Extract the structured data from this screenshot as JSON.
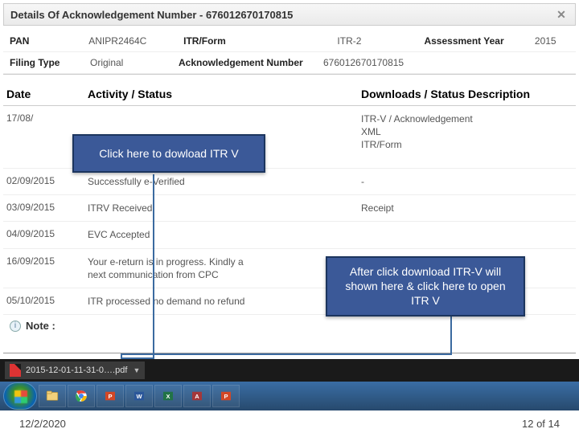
{
  "dialog": {
    "title": "Details Of Acknowledgement Number - 676012670170815"
  },
  "info": {
    "pan_label": "PAN",
    "pan": "ANIPR2464C",
    "itrform_label": "ITR/Form",
    "itrform": "ITR-2",
    "ay_label": "Assessment Year",
    "ay": "2015",
    "filing_label": "Filing Type",
    "filing": "Original",
    "ack_label": "Acknowledgement Number",
    "ack": "676012670170815"
  },
  "headers": {
    "date": "Date",
    "activity": "Activity / Status",
    "downloads": "Downloads / Status Description"
  },
  "rows": [
    {
      "date": "17/08/",
      "activity": "",
      "downloads": "ITR-V / Acknowledgement\nXML\nITR/Form"
    },
    {
      "date": "02/09/2015",
      "activity": "Successfully e-Verified",
      "downloads": "-"
    },
    {
      "date": "03/09/2015",
      "activity": "ITRV Received",
      "downloads": "Receipt"
    },
    {
      "date": "04/09/2015",
      "activity": "EVC Accepted",
      "downloads": ""
    },
    {
      "date": "16/09/2015",
      "activity": "Your e-return is in progress. Kindly a\nnext communication from CPC",
      "downloads": ""
    },
    {
      "date": "05/10/2015",
      "activity": "ITR processed no demand no refund",
      "downloads": "-"
    }
  ],
  "callouts": {
    "a": "Click here to dowload ITR V",
    "b": "After click download ITR-V will shown here & click here to open ITR V"
  },
  "note": {
    "label": "Note :"
  },
  "download_chip": "2015-12-01-11-31-0….pdf",
  "footer": {
    "date": "12/2/2020",
    "page": "12 of 14"
  }
}
